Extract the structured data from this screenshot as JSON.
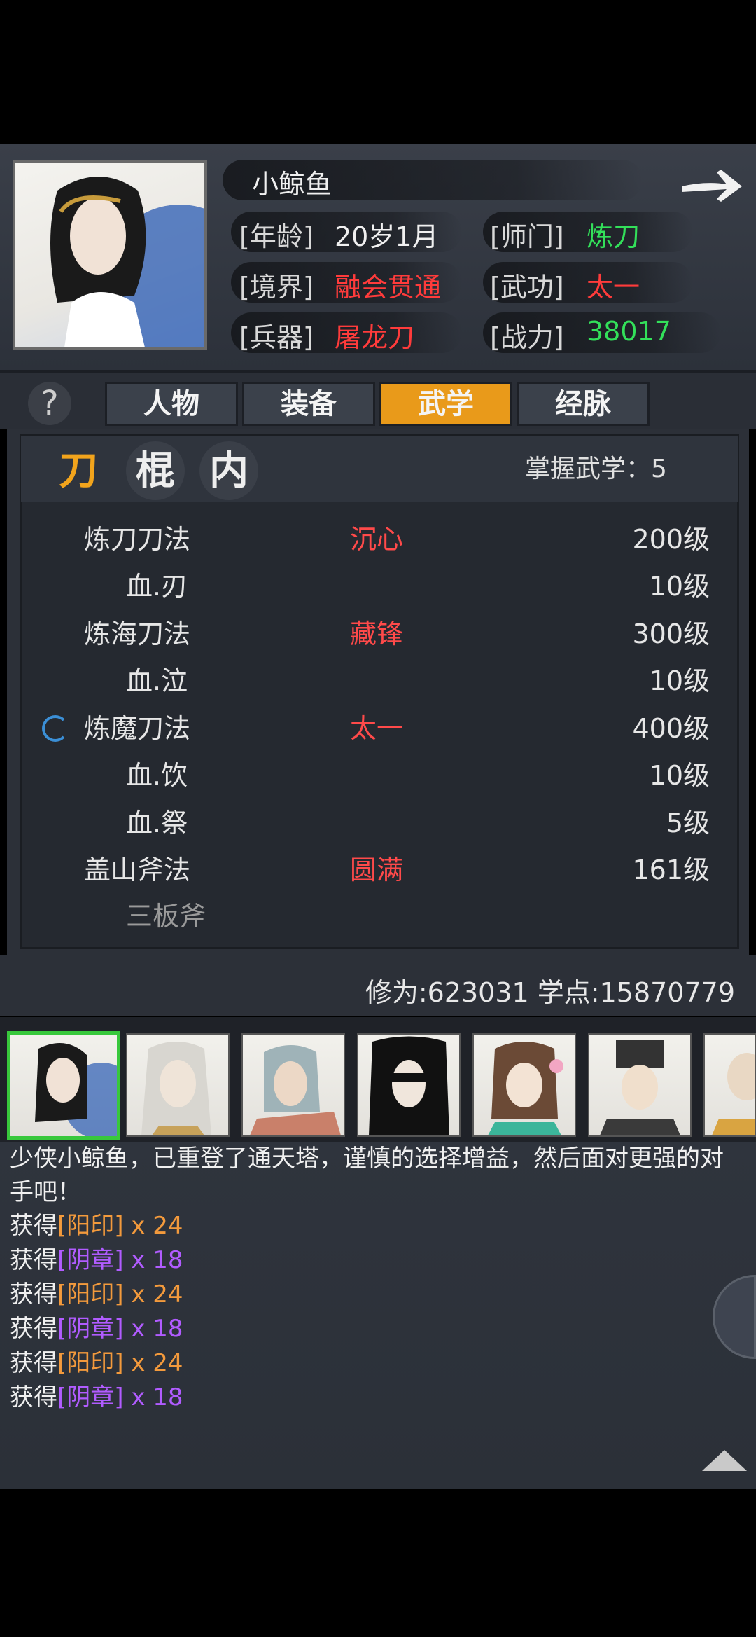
{
  "profile": {
    "name": "小鲸鱼",
    "fields": {
      "age_label": "[年龄]",
      "age": "20岁1月",
      "realm_label": "[境界]",
      "realm": "融会贯通",
      "weapon_label": "[兵器]",
      "weapon": "屠龙刀",
      "school_label": "[师门]",
      "school": "炼刀",
      "martial_label": "[武功]",
      "martial": "太一",
      "power_label": "[战力]",
      "power": "38017"
    }
  },
  "tabs": [
    "人物",
    "装备",
    "武学",
    "经脉"
  ],
  "active_tab": "武学",
  "help_label": "?",
  "categories": [
    "刀",
    "棍",
    "内"
  ],
  "active_category": "刀",
  "mastery": "掌握武学：5",
  "skills": [
    {
      "name": "炼刀刀法",
      "tag": "沉心",
      "level": "200级",
      "sub": false
    },
    {
      "name": "血.刃",
      "tag": "",
      "level": "10级",
      "sub": true
    },
    {
      "name": "炼海刀法",
      "tag": "藏锋",
      "level": "300级",
      "sub": false
    },
    {
      "name": "血.泣",
      "tag": "",
      "level": "10级",
      "sub": true
    },
    {
      "name": "炼魔刀法",
      "tag": "太一",
      "level": "400级",
      "sub": false
    },
    {
      "name": "血.饮",
      "tag": "",
      "level": "10级",
      "sub": true
    },
    {
      "name": "血.祭",
      "tag": "",
      "level": "5级",
      "sub": true
    },
    {
      "name": "盖山斧法",
      "tag": "圆满",
      "level": "161级",
      "sub": false
    },
    {
      "name": "三板斧",
      "tag": "",
      "level": "",
      "sub": true
    }
  ],
  "stats": {
    "cultivation": "修为:623031",
    "points": "学点:15870779"
  },
  "log": {
    "intro": "少侠小鲸鱼，已重登了通天塔，谨慎的选择增益，然后面对更强的对手吧！",
    "gain_prefix": "获得",
    "items": [
      {
        "name": "[阳印]",
        "qty": "x 24",
        "color": "orange"
      },
      {
        "name": "[阴章]",
        "qty": "x 18",
        "color": "purple"
      },
      {
        "name": "[阳印]",
        "qty": "x 24",
        "color": "orange"
      },
      {
        "name": "[阴章]",
        "qty": "x 18",
        "color": "purple"
      },
      {
        "name": "[阳印]",
        "qty": "x 24",
        "color": "orange"
      },
      {
        "name": "[阴章]",
        "qty": "x 18",
        "color": "purple"
      }
    ]
  },
  "colors": {
    "accent": "#e99a1a",
    "red": "#ff3b3b",
    "green": "#33e05a",
    "orange": "#f39a3c",
    "purple": "#b15cff"
  }
}
